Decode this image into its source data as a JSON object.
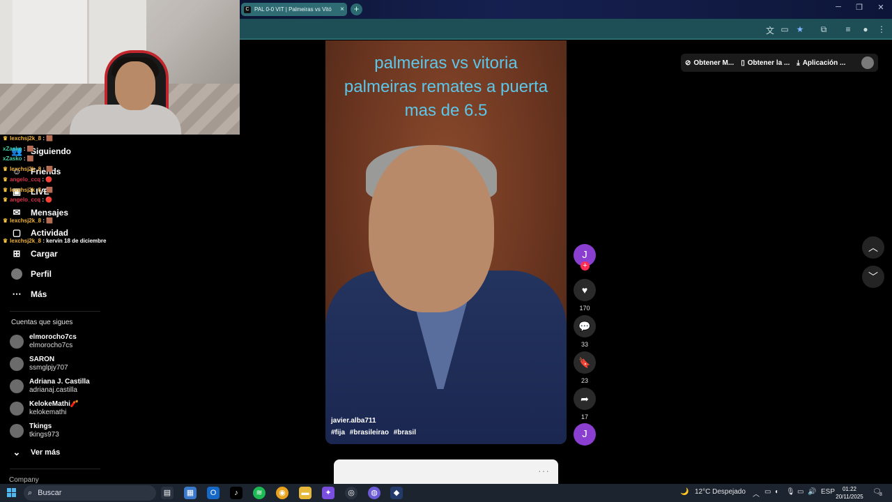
{
  "browser": {
    "tab_title": "PAL 0-0 VIT | Palmeiras vs Vitó",
    "tab_favicon": "C",
    "new_tab": "+",
    "close_tab": "×"
  },
  "chat": [
    {
      "user": "lexchsj2k_8",
      "color": "u1",
      "msg": ": 🟫"
    },
    {
      "user": "xZasko",
      "color": "u2",
      "msg": ": 🟫"
    },
    {
      "user": "lexchsj2k_8",
      "color": "u1",
      "msg": ": 🟫"
    },
    {
      "user": "angelo_ccq",
      "color": "u3",
      "msg": ": 🔴"
    },
    {
      "user": "lexchsj2k_8",
      "color": "u1",
      "msg": ": 🟫"
    },
    {
      "user": "angelo_ccq",
      "color": "u3",
      "msg": ": 🔴"
    },
    {
      "user": "lexchsj2k_8",
      "color": "u1",
      "msg": ": 🟫"
    },
    {
      "user": "lexchsj2k_8",
      "color": "u1",
      "msg": ": kervin 18 de diciembre"
    }
  ],
  "nav": {
    "siguiendo": "Siguiendo",
    "friends": "Friends",
    "live": "LIVE",
    "mensajes": "Mensajes",
    "actividad": "Actividad",
    "cargar": "Cargar",
    "perfil": "Perfil",
    "mas": "Más"
  },
  "following": {
    "title": "Cuentas que sigues",
    "accounts": [
      {
        "name": "elmorocho7cs",
        "handle": "elmorocho7cs"
      },
      {
        "name": "SARON",
        "handle": "ssmglpjy707"
      },
      {
        "name": "Adriana J. Castilla",
        "handle": "adrianaj.castilla"
      },
      {
        "name": "KelokeMathi🧨",
        "handle": "kelokemathi"
      },
      {
        "name": "Tkings",
        "handle": "tkings973"
      }
    ],
    "see_more": "Ver más",
    "company": "Company"
  },
  "video": {
    "title_lines": [
      "palmeiras vs vitoria",
      "palmeiras remates a puerta",
      "mas de 6.5"
    ],
    "username": "javier.alba711",
    "hashtags": [
      "#fija",
      "#brasileirao",
      "#brasil"
    ]
  },
  "actions": {
    "avatar_letter": "J",
    "likes": "170",
    "comments": "33",
    "saves": "23",
    "shares": "17"
  },
  "top_actions": {
    "obtener_m": "Obtener M...",
    "obtener_la": "Obtener la ...",
    "aplicacion": "Aplicación ..."
  },
  "taskbar": {
    "search": "Buscar",
    "weather": "12°C  Despejado",
    "lang": "ESP",
    "time": "01:22",
    "date": "20/11/2025",
    "notif": "8"
  },
  "colors": {
    "accent_tab": "#2f6b73",
    "like_red": "#fe2c55",
    "avatar_purple": "#8a3fd1",
    "video_title": "#5ec6e8"
  }
}
